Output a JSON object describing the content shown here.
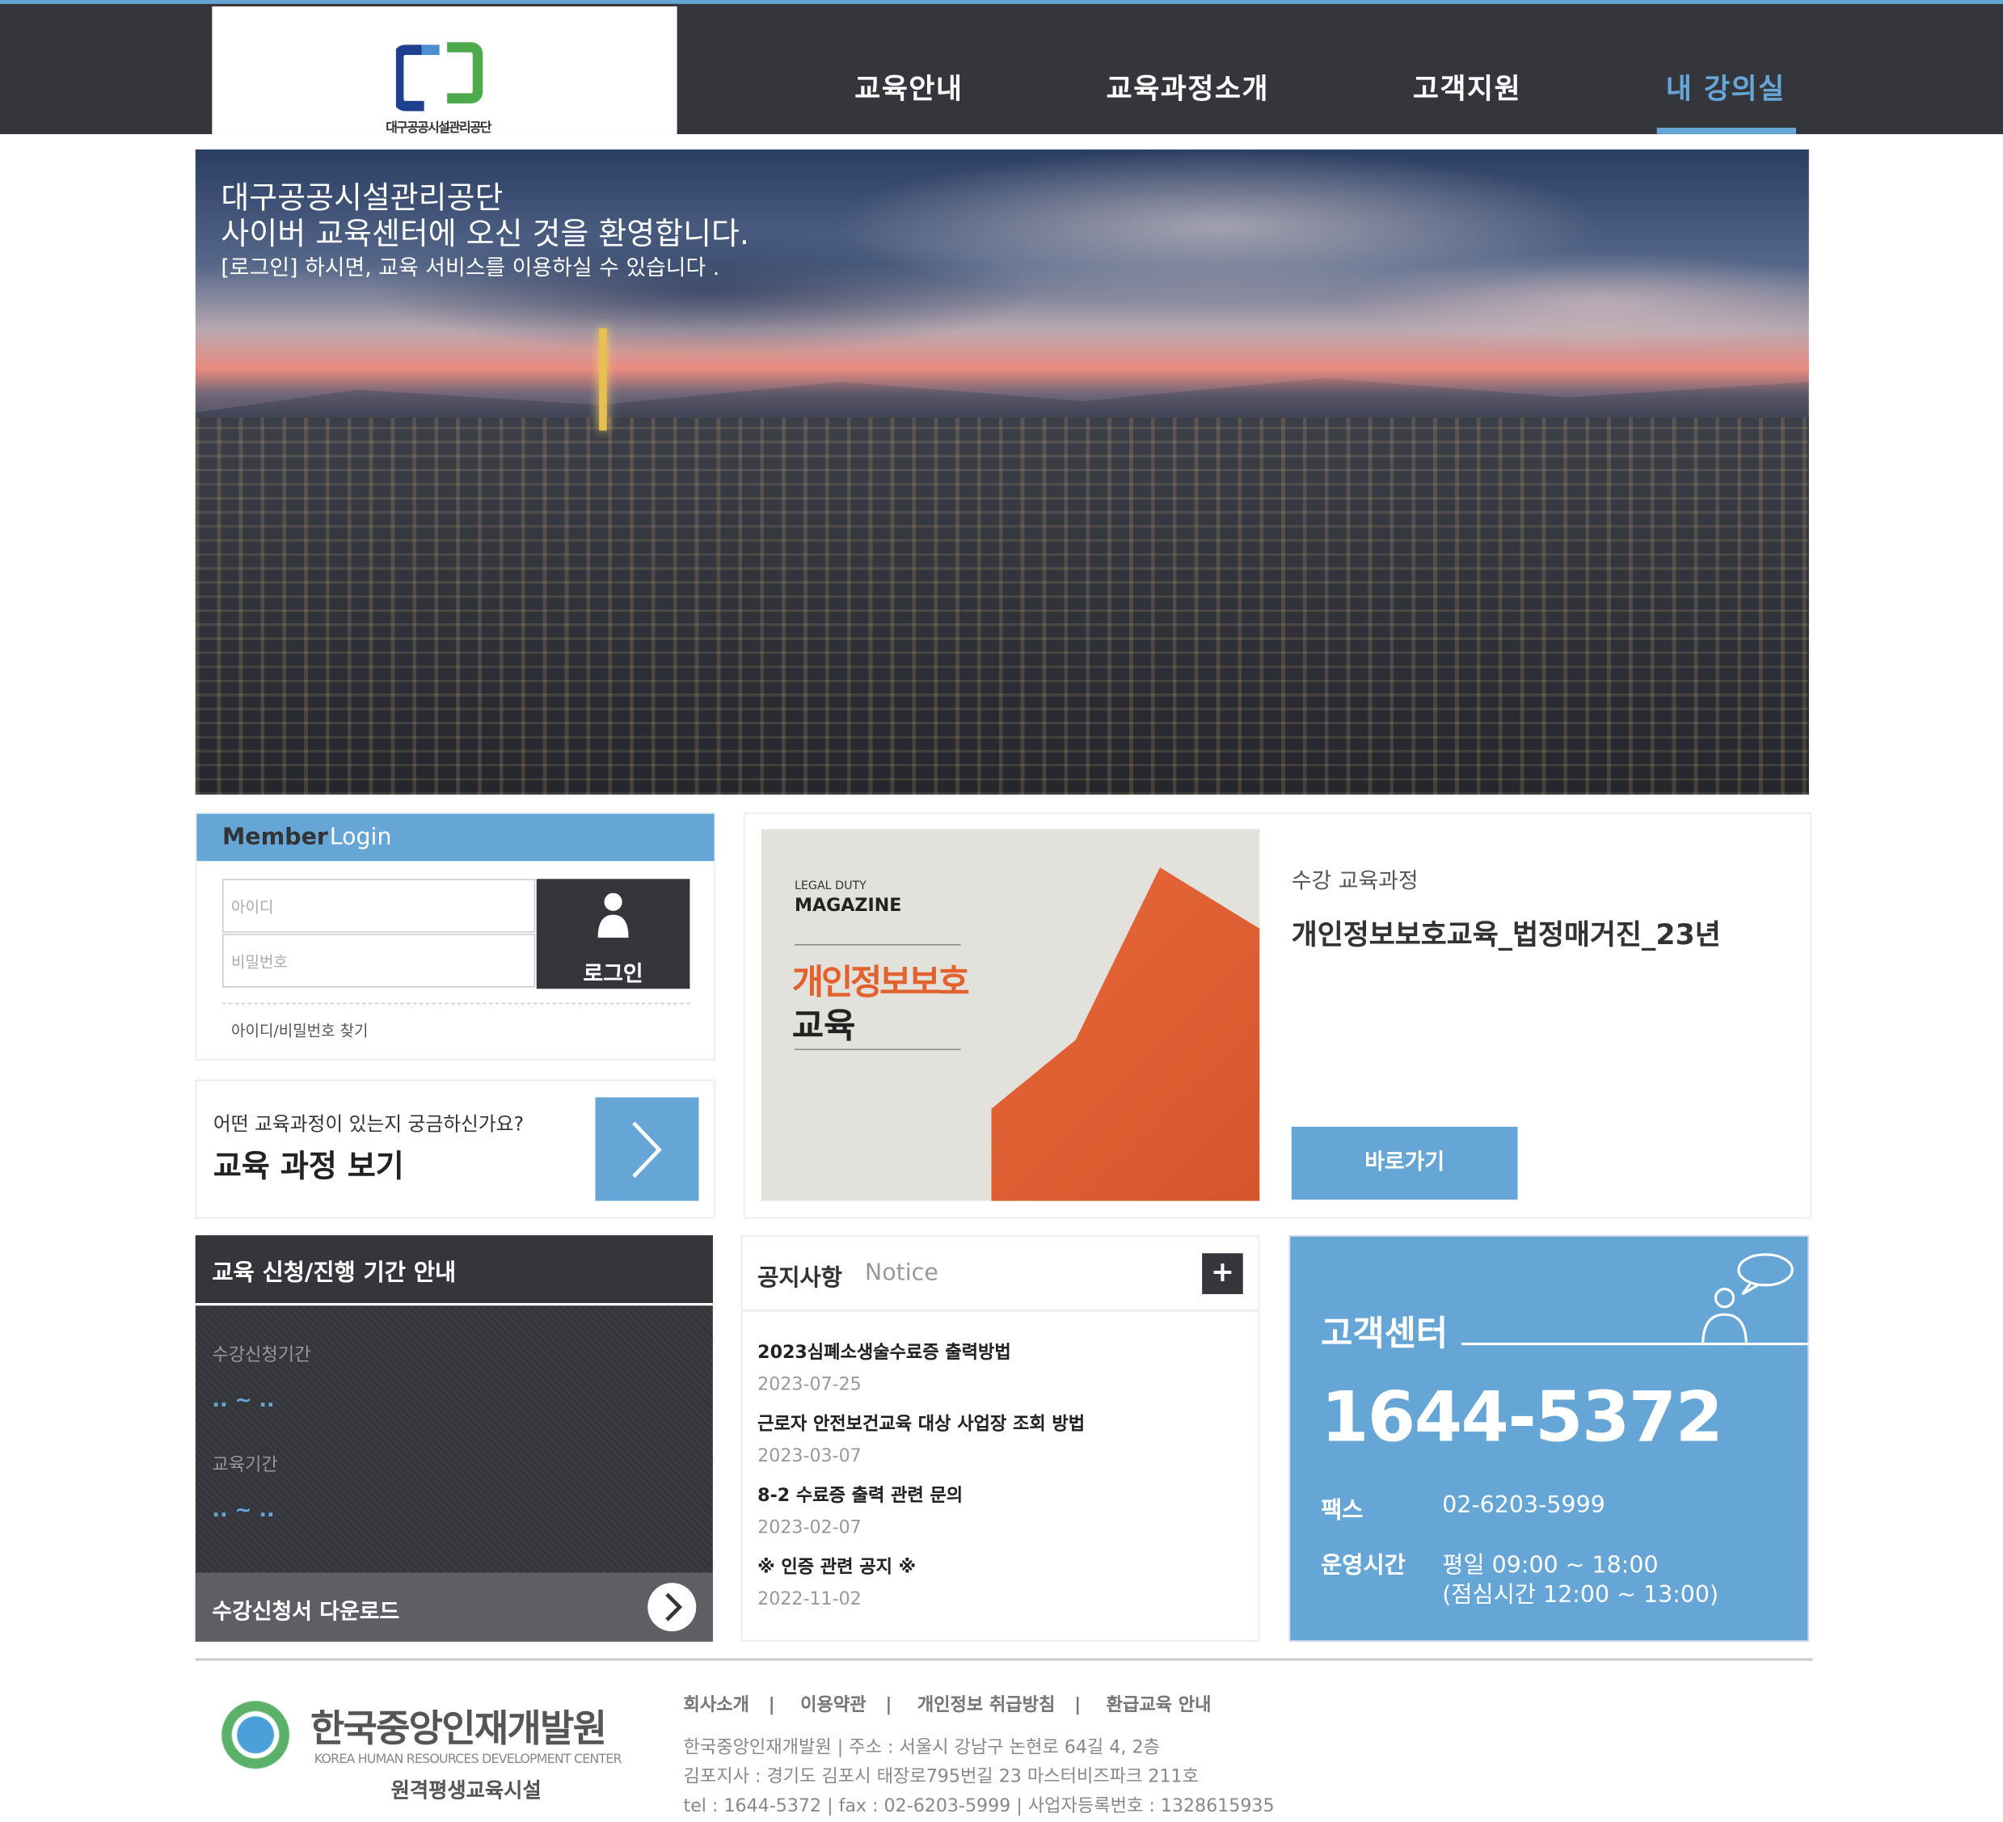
{
  "colors": {
    "accent": "#66a6d6",
    "dark": "#35363b"
  },
  "header": {
    "logo_text": "대구공공시설관리공단",
    "nav": [
      {
        "label": "교육안내"
      },
      {
        "label": "교육과정소개"
      },
      {
        "label": "고객지원"
      },
      {
        "label": "내 강의실",
        "active": true
      }
    ]
  },
  "hero": {
    "line1": "대구공공시설관리공단",
    "line2": "사이버 교육센터에 오신 것을 환영합니다.",
    "line3": "[로그인] 하시면,  교육 서비스를 이용하실 수 있습니다 ."
  },
  "login": {
    "title_bold": "Member",
    "title_light": "Login",
    "id_placeholder": "아이디",
    "pw_placeholder": "비밀번호",
    "button": "로그인",
    "button_icon": "user-icon",
    "find": "아이디/비밀번호 찾기"
  },
  "course_link": {
    "question": "어떤 교육과정이 있는지 궁금하신가요?",
    "title": "교육 과정 보기",
    "icon": "chevron-right-icon"
  },
  "featured": {
    "image": {
      "label1": "LEGAL DUTY",
      "label2": "MAGAZINE",
      "title1": "개인정보보호",
      "title2": "교육"
    },
    "subtitle": "수강 교육과정",
    "title": "개인정보보호교육_법정매거진_23년",
    "button": "바로가기"
  },
  "period": {
    "title": "교육 신청/진행 기간 안내",
    "apply_label": "수강신청기간",
    "apply_value": ".. ~ ..",
    "edu_label": "교육기간",
    "edu_value": ".. ~ ..",
    "download": "수강신청서 다운로드"
  },
  "notice": {
    "title": "공지사항",
    "title_en": "Notice",
    "more": "+",
    "items": [
      {
        "title": "2023심폐소생술수료증 출력방법",
        "date": "2023-07-25"
      },
      {
        "title": "근로자 안전보건교육 대상 사업장 조회 방법",
        "date": "2023-03-07"
      },
      {
        "title": "8-2 수료증 출력 관련 문의",
        "date": "2023-02-07"
      },
      {
        "title": "※ 인증 관련 공지 ※",
        "date": "2022-11-02"
      }
    ]
  },
  "customer": {
    "title": "고객센터",
    "phone": "1644-5372",
    "fax_label": "팩스",
    "fax": "02-6203-5999",
    "hours_label": "운영시간",
    "hours1": "평일 09:00 ~ 18:00",
    "hours2": "(점심시간 12:00 ~ 13:00)"
  },
  "footer": {
    "org": "한국중앙인재개발원",
    "org_en": "KOREA HUMAN RESOURCES DEVELOPMENT CENTER",
    "org_sub": "원격평생교육시설",
    "links": [
      "회사소개",
      "이용약관",
      "개인정보 취급방침",
      "환급교육 안내"
    ],
    "info1": "한국중앙인재개발원  |  주소 : 서울시 강남구 논현로 64길 4, 2층",
    "info2": "김포지사 : 경기도 김포시 태장로795번길 23 마스터비즈파크 211호",
    "info3": "tel : 1644-5372  |  fax : 02-6203-5999  |  사업자등록번호 : 1328615935"
  }
}
